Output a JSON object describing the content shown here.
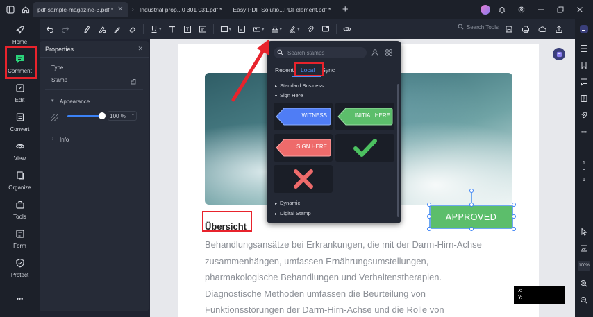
{
  "titlebar": {
    "tabs": [
      {
        "label": "pdf-sample-magazine-3.pdf *",
        "active": true
      },
      {
        "label": "Industrial  prop...0 301 031.pdf *",
        "active": false
      },
      {
        "label": "Easy PDF Solutio...PDFelement.pdf *",
        "active": false
      }
    ],
    "new_tab": "+"
  },
  "rail": {
    "items": [
      {
        "label": "Home",
        "icon": "rocket-icon"
      },
      {
        "label": "Comment",
        "icon": "comment-icon"
      },
      {
        "label": "Edit",
        "icon": "edit-icon"
      },
      {
        "label": "Convert",
        "icon": "convert-icon"
      },
      {
        "label": "View",
        "icon": "eye-icon"
      },
      {
        "label": "Organize",
        "icon": "organize-icon"
      },
      {
        "label": "Tools",
        "icon": "toolbox-icon"
      },
      {
        "label": "Form",
        "icon": "form-icon"
      },
      {
        "label": "Protect",
        "icon": "shield-icon"
      }
    ],
    "more": "•••"
  },
  "toolbar": {
    "search_label": "Search Tools"
  },
  "properties": {
    "title": "Properties",
    "type_label": "Type",
    "type_value": "Stamp",
    "appearance_label": "Appearance",
    "opacity_value": "100 %",
    "opacity_fraction": 1.0,
    "info_label": "Info"
  },
  "stamps": {
    "search_placeholder": "Search stamps",
    "tabs": [
      "Recent",
      "Local",
      "Sync"
    ],
    "active_tab": "Local",
    "categories": {
      "standard": "Standard Business",
      "sign_here": "Sign Here",
      "dynamic": "Dynamic",
      "digital": "Digital Stamp"
    },
    "tiles": {
      "witness": "WITNESS",
      "initial_here": "INITIAL HERE",
      "sign_here": "SIGN HERE"
    }
  },
  "document": {
    "heading": "Übersicht",
    "paragraph_lines": [
      "Behandlungsansätze bei Erkrankungen, die mit der Darm-Hirn-Achse",
      "zusammenhängen, umfassen Ernährungsumstellungen,",
      "pharmakologische Behandlungen und Verhaltenstherapien.",
      "Diagnostische Methoden umfassen die Beurteilung von",
      "Funktionsstörungen der Darm-Hirn-Achse und die Rolle von"
    ],
    "stamp_label": "APPROVED",
    "coord_x": "X:",
    "coord_y": "Y:"
  },
  "right_rail": {
    "page_current": "1",
    "page_total": "1",
    "zoom": "100%"
  },
  "colors": {
    "accent_green": "#2bd37a",
    "highlight_red": "#e8232c",
    "witness_blue": "#4f7df5",
    "initial_green": "#5cbe6b",
    "sign_red": "#ee6b6b"
  }
}
